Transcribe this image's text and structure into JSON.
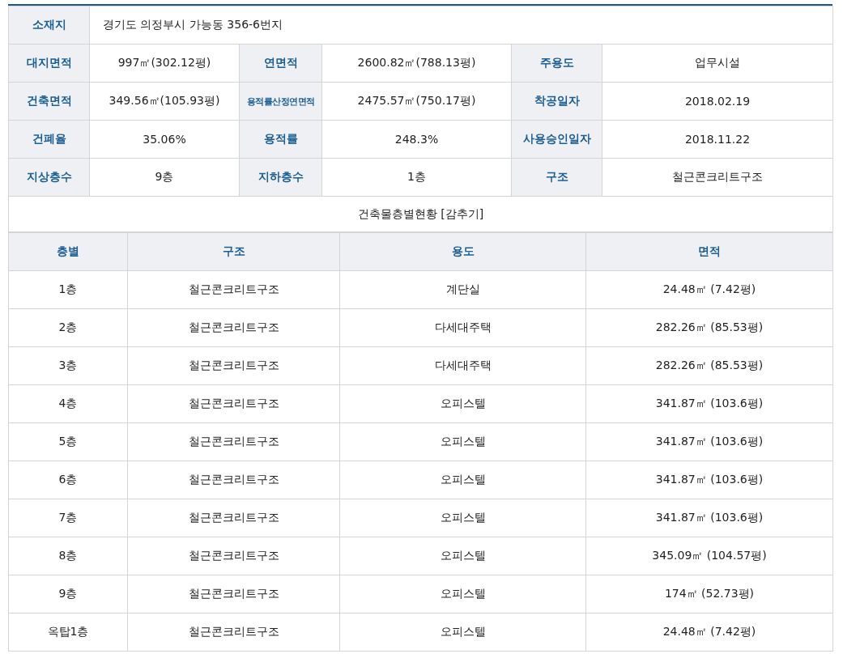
{
  "summary": {
    "address_label": "소재지",
    "address": "경기도 의정부시 가능동 356-6번지",
    "rows": [
      [
        {
          "label": "대지면적",
          "value": "997㎡(302.12평)"
        },
        {
          "label": "연면적",
          "value": "2600.82㎡(788.13평)"
        },
        {
          "label": "주용도",
          "value": "업무시설"
        }
      ],
      [
        {
          "label": "건축면적",
          "value": "349.56㎡(105.93평)"
        },
        {
          "label": "용적률산정연면적",
          "value": "2475.57㎡(750.17평)"
        },
        {
          "label": "착공일자",
          "value": "2018.02.19"
        }
      ],
      [
        {
          "label": "건폐율",
          "value": "35.06%"
        },
        {
          "label": "용적률",
          "value": "248.3%"
        },
        {
          "label": "사용승인일자",
          "value": "2018.11.22"
        }
      ],
      [
        {
          "label": "지상층수",
          "value": "9층"
        },
        {
          "label": "지하층수",
          "value": "1층"
        },
        {
          "label": "구조",
          "value": "철근콘크리트구조"
        }
      ]
    ]
  },
  "floors": {
    "title": "건축물층별현황",
    "toggle": "[감추기]",
    "columns": [
      "층별",
      "구조",
      "용도",
      "면적"
    ],
    "rows": [
      [
        "1층",
        "철근콘크리트구조",
        "계단실",
        "24.48㎡ (7.42평)"
      ],
      [
        "2층",
        "철근콘크리트구조",
        "다세대주택",
        "282.26㎡ (85.53평)"
      ],
      [
        "3층",
        "철근콘크리트구조",
        "다세대주택",
        "282.26㎡ (85.53평)"
      ],
      [
        "4층",
        "철근콘크리트구조",
        "오피스텔",
        "341.87㎡ (103.6평)"
      ],
      [
        "5층",
        "철근콘크리트구조",
        "오피스텔",
        "341.87㎡ (103.6평)"
      ],
      [
        "6층",
        "철근콘크리트구조",
        "오피스텔",
        "341.87㎡ (103.6평)"
      ],
      [
        "7층",
        "철근콘크리트구조",
        "오피스텔",
        "341.87㎡ (103.6평)"
      ],
      [
        "8층",
        "철근콘크리트구조",
        "오피스텔",
        "345.09㎡ (104.57평)"
      ],
      [
        "9층",
        "철근콘크리트구조",
        "오피스텔",
        "174㎡ (52.73평)"
      ],
      [
        "옥탑1층",
        "철근콘크리트구조",
        "오피스텔",
        "24.48㎡ (7.42평)"
      ]
    ]
  }
}
